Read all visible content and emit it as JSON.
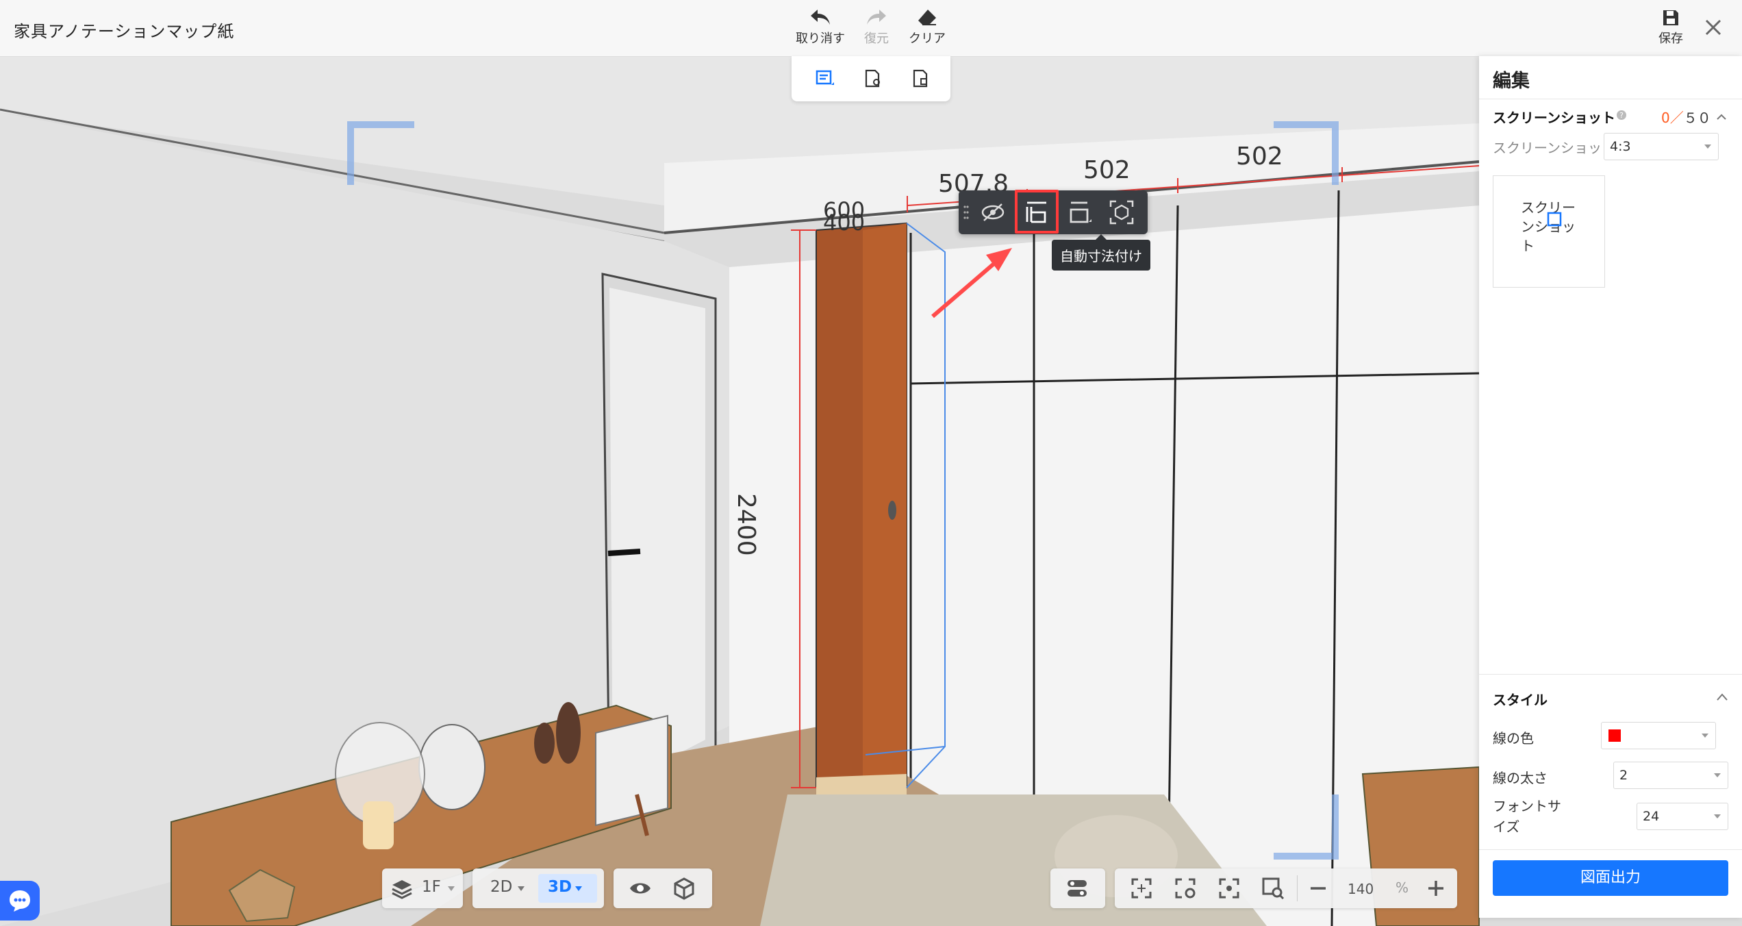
{
  "app": {
    "title": "家具アノテーションマップ紙"
  },
  "toolbar": {
    "undo_label": "取り消す",
    "redo_label": "復元",
    "clear_label": "クリア",
    "save_label": "保存"
  },
  "float_toolbar": {
    "tooltip": "自動寸法付け"
  },
  "dimensions": {
    "w1": "507.8",
    "w2": "502",
    "w3": "502",
    "depth1": "600",
    "depth2": "400",
    "height": "2400"
  },
  "right_panel": {
    "title": "編集",
    "screenshot_section": {
      "label": "スクリーンショット",
      "count_current": "0",
      "count_sep": "／",
      "count_max": "５０",
      "ratio_label": "スクリーンショット比率",
      "ratio_value": "4:3",
      "thumb_text": "スクリーンショット"
    },
    "style_section": {
      "label": "スタイル",
      "line_color_label": "線の色",
      "line_color": "#ff0000",
      "line_width_label": "線の太さ",
      "line_width_value": "2",
      "font_size_label": "フォントサイズ",
      "font_size_value": "24"
    },
    "export_label": "図面出力"
  },
  "bottom_bar": {
    "floor": "1F",
    "view_2d": "2D",
    "view_3d": "3D",
    "zoom_value": "140",
    "zoom_unit": "%"
  },
  "colors": {
    "accent": "#1677ff",
    "highlight": "#ff3b3b",
    "dimension_line": "#e53935"
  }
}
